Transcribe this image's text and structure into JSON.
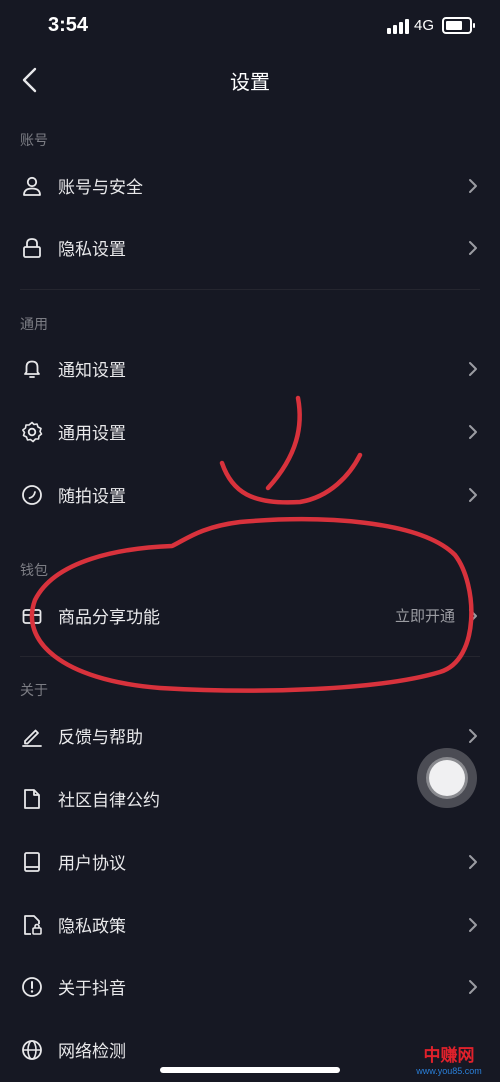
{
  "status_bar": {
    "time": "3:54",
    "network": "4G"
  },
  "nav": {
    "title": "设置"
  },
  "sections": {
    "account": {
      "label": "账号",
      "items": [
        "账号与安全",
        "隐私设置"
      ]
    },
    "general": {
      "label": "通用",
      "items": [
        "通知设置",
        "通用设置",
        "随拍设置"
      ]
    },
    "wallet": {
      "label": "钱包",
      "item": "商品分享功能",
      "action": "立即开通"
    },
    "about": {
      "label": "关于",
      "items": [
        "反馈与帮助",
        "社区自律公约",
        "用户协议",
        "隐私政策",
        "关于抖音",
        "网络检测"
      ]
    }
  },
  "annotation_color": "#d8323c",
  "watermark": {
    "text": "中赚网",
    "url": "www.you85.com"
  }
}
